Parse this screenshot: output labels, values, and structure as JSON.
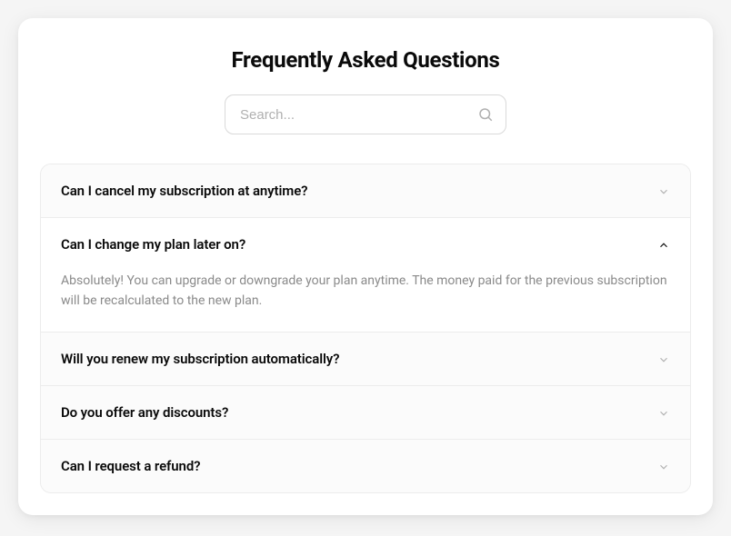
{
  "title": "Frequently Asked Questions",
  "search": {
    "placeholder": "Search..."
  },
  "faq": [
    {
      "question": "Can I cancel my subscription at anytime?",
      "expanded": false
    },
    {
      "question": "Can I change my plan later on?",
      "answer": "Absolutely! You can upgrade or downgrade your plan anytime. The money paid for the previous subscription will be recalculated to the new plan.",
      "expanded": true
    },
    {
      "question": "Will you renew my subscription automatically?",
      "expanded": false
    },
    {
      "question": "Do you offer any discounts?",
      "expanded": false
    },
    {
      "question": "Can I request a refund?",
      "expanded": false
    }
  ]
}
